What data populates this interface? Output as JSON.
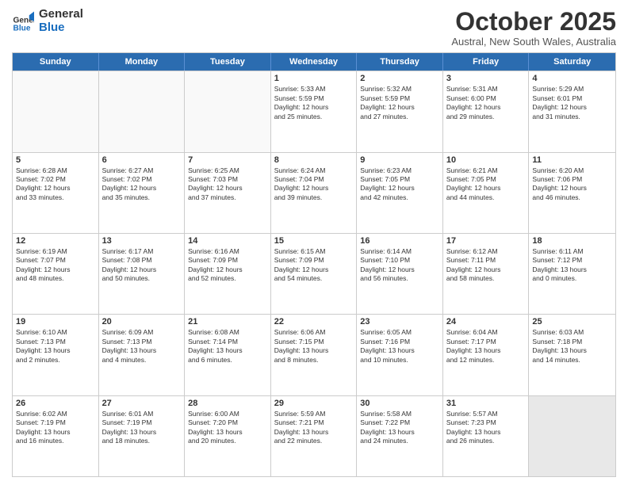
{
  "logo": {
    "text_general": "General",
    "text_blue": "Blue"
  },
  "header": {
    "month": "October 2025",
    "location": "Austral, New South Wales, Australia"
  },
  "days_of_week": [
    "Sunday",
    "Monday",
    "Tuesday",
    "Wednesday",
    "Thursday",
    "Friday",
    "Saturday"
  ],
  "rows": [
    [
      {
        "num": "",
        "lines": []
      },
      {
        "num": "",
        "lines": []
      },
      {
        "num": "",
        "lines": []
      },
      {
        "num": "1",
        "lines": [
          "Sunrise: 5:33 AM",
          "Sunset: 5:59 PM",
          "Daylight: 12 hours",
          "and 25 minutes."
        ]
      },
      {
        "num": "2",
        "lines": [
          "Sunrise: 5:32 AM",
          "Sunset: 5:59 PM",
          "Daylight: 12 hours",
          "and 27 minutes."
        ]
      },
      {
        "num": "3",
        "lines": [
          "Sunrise: 5:31 AM",
          "Sunset: 6:00 PM",
          "Daylight: 12 hours",
          "and 29 minutes."
        ]
      },
      {
        "num": "4",
        "lines": [
          "Sunrise: 5:29 AM",
          "Sunset: 6:01 PM",
          "Daylight: 12 hours",
          "and 31 minutes."
        ]
      }
    ],
    [
      {
        "num": "5",
        "lines": [
          "Sunrise: 6:28 AM",
          "Sunset: 7:02 PM",
          "Daylight: 12 hours",
          "and 33 minutes."
        ]
      },
      {
        "num": "6",
        "lines": [
          "Sunrise: 6:27 AM",
          "Sunset: 7:02 PM",
          "Daylight: 12 hours",
          "and 35 minutes."
        ]
      },
      {
        "num": "7",
        "lines": [
          "Sunrise: 6:25 AM",
          "Sunset: 7:03 PM",
          "Daylight: 12 hours",
          "and 37 minutes."
        ]
      },
      {
        "num": "8",
        "lines": [
          "Sunrise: 6:24 AM",
          "Sunset: 7:04 PM",
          "Daylight: 12 hours",
          "and 39 minutes."
        ]
      },
      {
        "num": "9",
        "lines": [
          "Sunrise: 6:23 AM",
          "Sunset: 7:05 PM",
          "Daylight: 12 hours",
          "and 42 minutes."
        ]
      },
      {
        "num": "10",
        "lines": [
          "Sunrise: 6:21 AM",
          "Sunset: 7:05 PM",
          "Daylight: 12 hours",
          "and 44 minutes."
        ]
      },
      {
        "num": "11",
        "lines": [
          "Sunrise: 6:20 AM",
          "Sunset: 7:06 PM",
          "Daylight: 12 hours",
          "and 46 minutes."
        ]
      }
    ],
    [
      {
        "num": "12",
        "lines": [
          "Sunrise: 6:19 AM",
          "Sunset: 7:07 PM",
          "Daylight: 12 hours",
          "and 48 minutes."
        ]
      },
      {
        "num": "13",
        "lines": [
          "Sunrise: 6:17 AM",
          "Sunset: 7:08 PM",
          "Daylight: 12 hours",
          "and 50 minutes."
        ]
      },
      {
        "num": "14",
        "lines": [
          "Sunrise: 6:16 AM",
          "Sunset: 7:09 PM",
          "Daylight: 12 hours",
          "and 52 minutes."
        ]
      },
      {
        "num": "15",
        "lines": [
          "Sunrise: 6:15 AM",
          "Sunset: 7:09 PM",
          "Daylight: 12 hours",
          "and 54 minutes."
        ]
      },
      {
        "num": "16",
        "lines": [
          "Sunrise: 6:14 AM",
          "Sunset: 7:10 PM",
          "Daylight: 12 hours",
          "and 56 minutes."
        ]
      },
      {
        "num": "17",
        "lines": [
          "Sunrise: 6:12 AM",
          "Sunset: 7:11 PM",
          "Daylight: 12 hours",
          "and 58 minutes."
        ]
      },
      {
        "num": "18",
        "lines": [
          "Sunrise: 6:11 AM",
          "Sunset: 7:12 PM",
          "Daylight: 13 hours",
          "and 0 minutes."
        ]
      }
    ],
    [
      {
        "num": "19",
        "lines": [
          "Sunrise: 6:10 AM",
          "Sunset: 7:13 PM",
          "Daylight: 13 hours",
          "and 2 minutes."
        ]
      },
      {
        "num": "20",
        "lines": [
          "Sunrise: 6:09 AM",
          "Sunset: 7:13 PM",
          "Daylight: 13 hours",
          "and 4 minutes."
        ]
      },
      {
        "num": "21",
        "lines": [
          "Sunrise: 6:08 AM",
          "Sunset: 7:14 PM",
          "Daylight: 13 hours",
          "and 6 minutes."
        ]
      },
      {
        "num": "22",
        "lines": [
          "Sunrise: 6:06 AM",
          "Sunset: 7:15 PM",
          "Daylight: 13 hours",
          "and 8 minutes."
        ]
      },
      {
        "num": "23",
        "lines": [
          "Sunrise: 6:05 AM",
          "Sunset: 7:16 PM",
          "Daylight: 13 hours",
          "and 10 minutes."
        ]
      },
      {
        "num": "24",
        "lines": [
          "Sunrise: 6:04 AM",
          "Sunset: 7:17 PM",
          "Daylight: 13 hours",
          "and 12 minutes."
        ]
      },
      {
        "num": "25",
        "lines": [
          "Sunrise: 6:03 AM",
          "Sunset: 7:18 PM",
          "Daylight: 13 hours",
          "and 14 minutes."
        ]
      }
    ],
    [
      {
        "num": "26",
        "lines": [
          "Sunrise: 6:02 AM",
          "Sunset: 7:19 PM",
          "Daylight: 13 hours",
          "and 16 minutes."
        ]
      },
      {
        "num": "27",
        "lines": [
          "Sunrise: 6:01 AM",
          "Sunset: 7:19 PM",
          "Daylight: 13 hours",
          "and 18 minutes."
        ]
      },
      {
        "num": "28",
        "lines": [
          "Sunrise: 6:00 AM",
          "Sunset: 7:20 PM",
          "Daylight: 13 hours",
          "and 20 minutes."
        ]
      },
      {
        "num": "29",
        "lines": [
          "Sunrise: 5:59 AM",
          "Sunset: 7:21 PM",
          "Daylight: 13 hours",
          "and 22 minutes."
        ]
      },
      {
        "num": "30",
        "lines": [
          "Sunrise: 5:58 AM",
          "Sunset: 7:22 PM",
          "Daylight: 13 hours",
          "and 24 minutes."
        ]
      },
      {
        "num": "31",
        "lines": [
          "Sunrise: 5:57 AM",
          "Sunset: 7:23 PM",
          "Daylight: 13 hours",
          "and 26 minutes."
        ]
      },
      {
        "num": "",
        "lines": []
      }
    ]
  ]
}
